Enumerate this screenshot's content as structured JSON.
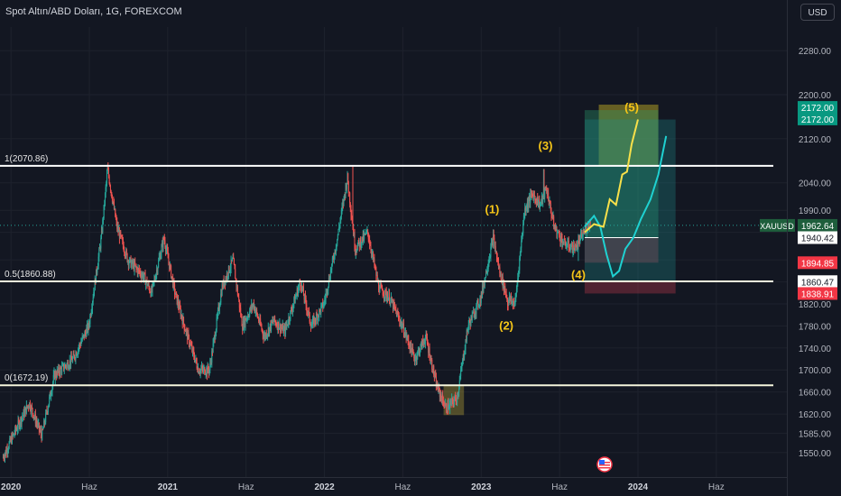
{
  "header": {
    "symbol_title": "Spot Altın/ABD Doları, 1G, FOREXCOM",
    "currency_button": "USD"
  },
  "chart_data": {
    "type": "candlestick",
    "instrument": "XAUUSD",
    "timeframe": "1G",
    "ylim": [
      1530,
      2300
    ],
    "y_ticks": [
      1550.0,
      1585.0,
      1620.0,
      1660.0,
      1700.0,
      1740.0,
      1780.0,
      1820.0,
      1860.0,
      1900.0,
      1950.0,
      1990.0,
      2040.0,
      2120.0,
      2200.0,
      2280.0
    ],
    "y_tick_labels": [
      "1550.00",
      "1585.00",
      "1620.00",
      "1660.00",
      "1700.00",
      "1740.00",
      "1780.00",
      "1820.00",
      "",
      "",
      "",
      "1990.00",
      "2040.00",
      "2120.00",
      "2200.00",
      "2280.00"
    ],
    "x_ticks": [
      {
        "t": 2020.0,
        "label": "2020",
        "bold": true
      },
      {
        "t": 2020.5,
        "label": "Haz",
        "bold": false
      },
      {
        "t": 2021.0,
        "label": "2021",
        "bold": true
      },
      {
        "t": 2021.5,
        "label": "Haz",
        "bold": false
      },
      {
        "t": 2022.0,
        "label": "2022",
        "bold": true
      },
      {
        "t": 2022.5,
        "label": "Haz",
        "bold": false
      },
      {
        "t": 2023.0,
        "label": "2023",
        "bold": true
      },
      {
        "t": 2023.5,
        "label": "Haz",
        "bold": false
      },
      {
        "t": 2024.0,
        "label": "2024",
        "bold": true
      },
      {
        "t": 2024.5,
        "label": "Haz",
        "bold": false
      }
    ],
    "xlim": [
      2019.93,
      2024.95
    ],
    "price_path": [
      [
        2019.95,
        1540
      ],
      [
        2020.05,
        1600
      ],
      [
        2020.12,
        1640
      ],
      [
        2020.2,
        1580
      ],
      [
        2020.28,
        1690
      ],
      [
        2020.4,
        1720
      ],
      [
        2020.5,
        1780
      ],
      [
        2020.58,
        1940
      ],
      [
        2020.62,
        2065
      ],
      [
        2020.68,
        1960
      ],
      [
        2020.75,
        1900
      ],
      [
        2020.85,
        1870
      ],
      [
        2020.9,
        1840
      ],
      [
        2020.98,
        1940
      ],
      [
        2021.05,
        1840
      ],
      [
        2021.12,
        1770
      ],
      [
        2021.2,
        1700
      ],
      [
        2021.27,
        1700
      ],
      [
        2021.35,
        1850
      ],
      [
        2021.42,
        1900
      ],
      [
        2021.48,
        1780
      ],
      [
        2021.55,
        1820
      ],
      [
        2021.62,
        1760
      ],
      [
        2021.68,
        1790
      ],
      [
        2021.75,
        1770
      ],
      [
        2021.85,
        1860
      ],
      [
        2021.92,
        1780
      ],
      [
        2022.0,
        1820
      ],
      [
        2022.08,
        1930
      ],
      [
        2022.15,
        2050
      ],
      [
        2022.2,
        1920
      ],
      [
        2022.28,
        1950
      ],
      [
        2022.35,
        1850
      ],
      [
        2022.42,
        1830
      ],
      [
        2022.5,
        1780
      ],
      [
        2022.58,
        1720
      ],
      [
        2022.65,
        1760
      ],
      [
        2022.72,
        1670
      ],
      [
        2022.78,
        1630
      ],
      [
        2022.85,
        1650
      ],
      [
        2022.92,
        1780
      ],
      [
        2023.0,
        1830
      ],
      [
        2023.08,
        1940
      ],
      [
        2023.12,
        1880
      ],
      [
        2023.17,
        1830
      ],
      [
        2023.22,
        1820
      ],
      [
        2023.28,
        1990
      ],
      [
        2023.33,
        2020
      ],
      [
        2023.38,
        2000
      ],
      [
        2023.42,
        2030
      ],
      [
        2023.47,
        1960
      ],
      [
        2023.53,
        1930
      ],
      [
        2023.6,
        1920
      ],
      [
        2023.66,
        1950
      ],
      [
        2023.7,
        1970
      ]
    ],
    "extrema": [
      {
        "t": 2019.97,
        "v": 1540
      },
      {
        "t": 2020.62,
        "v": 2072
      },
      {
        "t": 2021.25,
        "v": 1682
      },
      {
        "t": 2022.18,
        "v": 2072
      },
      {
        "t": 2022.8,
        "v": 1620
      },
      {
        "t": 2023.08,
        "v": 1955
      },
      {
        "t": 2023.17,
        "v": 1808
      },
      {
        "t": 2023.4,
        "v": 2065
      },
      {
        "t": 2023.62,
        "v": 1898
      }
    ],
    "fib_levels": [
      {
        "label": "1(2070.86)",
        "value": 2070.86,
        "color": "#ffffff"
      },
      {
        "label": "0.5(1860.88)",
        "value": 1860.88,
        "color": "#f5f5dc"
      },
      {
        "label": "0(1672.19)",
        "value": 1672.19,
        "color": "#f5f5dc"
      }
    ],
    "wave_labels": [
      {
        "label": "(1)",
        "t": 2023.07,
        "v": 1985
      },
      {
        "label": "(2)",
        "t": 2023.16,
        "v": 1773
      },
      {
        "label": "(3)",
        "t": 2023.41,
        "v": 2100
      },
      {
        "label": "(4)",
        "t": 2023.62,
        "v": 1866
      },
      {
        "label": "(5)",
        "t": 2023.96,
        "v": 2170
      }
    ],
    "boxes": [
      {
        "name": "bottom-zone-box",
        "t0": 2022.76,
        "t1": 2022.89,
        "v0": 1618,
        "v1": 1672,
        "fill": "#c8b23a",
        "opacity": 0.35
      },
      {
        "name": "target-zone-box",
        "t0": 2023.75,
        "t1": 2024.13,
        "v0": 2072,
        "v1": 2182,
        "fill": "#9e8f24",
        "opacity": 0.6
      },
      {
        "name": "long-profit-box",
        "t0": 2023.66,
        "t1": 2024.13,
        "v0": 1940.42,
        "v1": 2172,
        "fill": "#2a9e6e",
        "opacity": 0.35
      },
      {
        "name": "long-stop-box",
        "t0": 2023.66,
        "t1": 2024.13,
        "v0": 1894.85,
        "v1": 1940.42,
        "fill": "#8e3040",
        "opacity": 0.5
      },
      {
        "name": "short-profit-box",
        "t0": 2023.66,
        "t1": 2024.24,
        "v0": 1860.47,
        "v1": 2155,
        "fill": "#1f8f8f",
        "opacity": 0.3
      },
      {
        "name": "short-stop-box",
        "t0": 2023.66,
        "t1": 2024.24,
        "v0": 1838.91,
        "v1": 1860.47,
        "fill": "#8e3040",
        "opacity": 0.5
      }
    ],
    "entry_line": {
      "t0": 2023.66,
      "t1": 2024.13,
      "v": 1940.42
    },
    "yellow_projection": [
      [
        2023.66,
        1950
      ],
      [
        2023.72,
        1965
      ],
      [
        2023.78,
        1960
      ],
      [
        2023.82,
        2010
      ],
      [
        2023.86,
        2000
      ],
      [
        2023.9,
        2055
      ],
      [
        2023.93,
        2060
      ],
      [
        2023.96,
        2110
      ],
      [
        2024.0,
        2155
      ]
    ],
    "cyan_projection": [
      [
        2023.66,
        1960
      ],
      [
        2023.72,
        1980
      ],
      [
        2023.76,
        1960
      ],
      [
        2023.8,
        1910
      ],
      [
        2023.84,
        1870
      ],
      [
        2023.88,
        1880
      ],
      [
        2023.92,
        1920
      ],
      [
        2023.97,
        1940
      ],
      [
        2024.02,
        1975
      ],
      [
        2024.08,
        2010
      ],
      [
        2024.13,
        2055
      ],
      [
        2024.18,
        2125
      ]
    ],
    "price_labels": [
      {
        "text": "2172.00",
        "value": 2177,
        "bg": "#089981",
        "fg": "#ffffff"
      },
      {
        "text": "2172.00",
        "value": 2156,
        "bg": "#089981",
        "fg": "#ffffff"
      },
      {
        "text": "1962.64",
        "value": 1962.64,
        "bg": "#1e5e3c",
        "fg": "#ffffff",
        "tag": "XAUUSD"
      },
      {
        "text": "1940.42",
        "value": 1940.42,
        "bg": "#ffffff",
        "fg": "#131722"
      },
      {
        "text": "1894.85",
        "value": 1894.85,
        "bg": "#f23645",
        "fg": "#ffffff"
      },
      {
        "text": "1860.47",
        "value": 1860.47,
        "bg": "#ffffff",
        "fg": "#131722"
      },
      {
        "text": "1838.91",
        "value": 1838.91,
        "bg": "#f23645",
        "fg": "#ffffff"
      }
    ],
    "current_price": 1962.64,
    "colors": {
      "up": "#26a69a",
      "down": "#ef5350",
      "background": "#131722",
      "grid": "#1e222d",
      "text": "#b2b5be",
      "wave": "#f5c518",
      "yellow": "#f8e04a",
      "cyan": "#1fd1d1"
    }
  }
}
